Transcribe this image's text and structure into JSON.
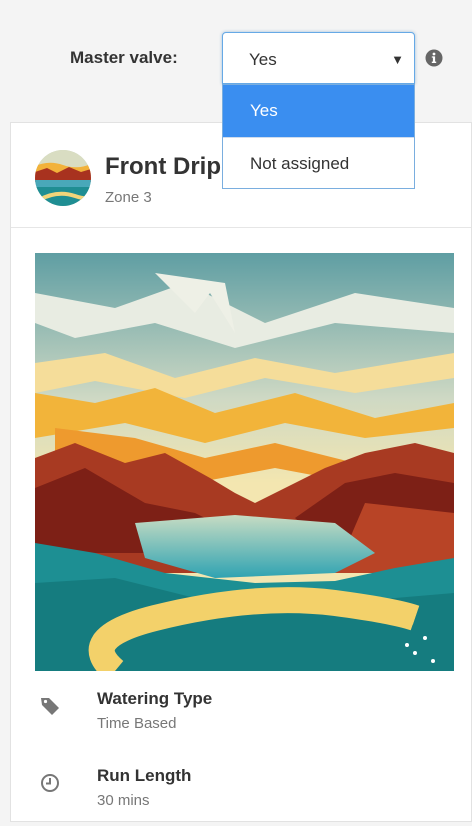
{
  "master_valve": {
    "label": "Master valve:",
    "selected": "Yes",
    "options": [
      "Yes",
      "Not assigned"
    ]
  },
  "zone": {
    "name": "Front Drip",
    "subtitle": "Zone 3"
  },
  "details": [
    {
      "title": "Watering Type",
      "value": "Time Based",
      "icon": "tag-icon"
    },
    {
      "title": "Run Length",
      "value": "30 mins",
      "icon": "clock-icon"
    }
  ],
  "colors": {
    "selected_option_bg": "#3a8ef0",
    "select_border": "#66a9e6",
    "page_bg": "#f4f4f4"
  }
}
